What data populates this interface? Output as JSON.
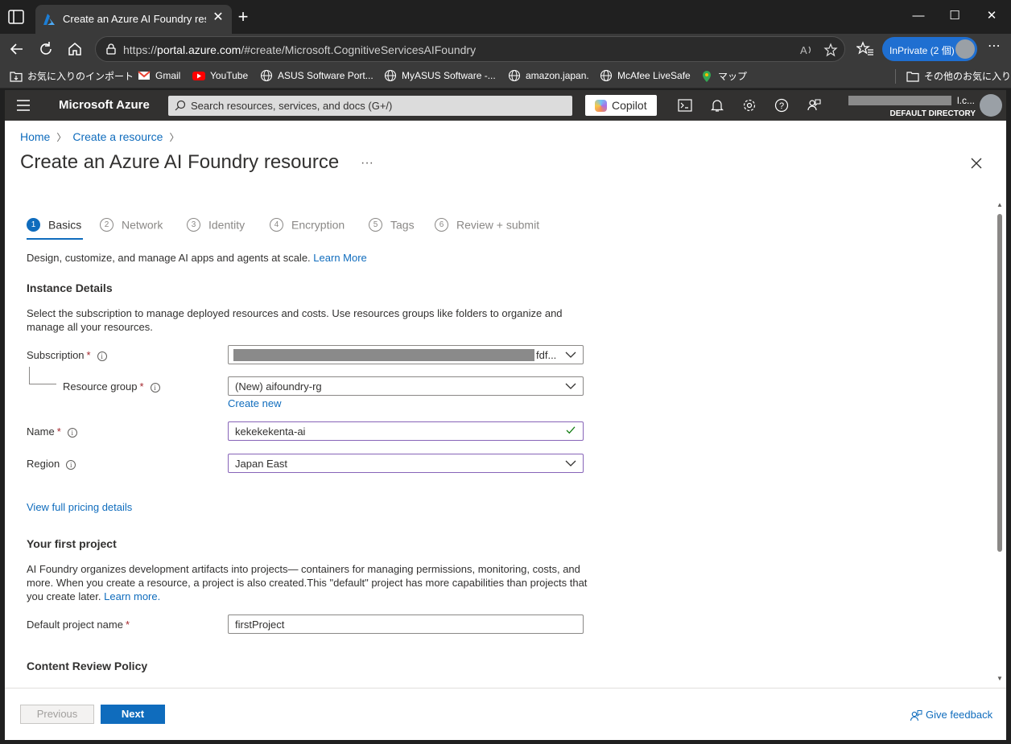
{
  "browser": {
    "tab_title": "Create an Azure AI Foundry resou",
    "url_prefix": "https://",
    "url_host": "portal.azure.com",
    "url_path": "/#create/Microsoft.CognitiveServicesAIFoundry",
    "inprivate_label": "InPrivate (2 個)"
  },
  "favorites": [
    {
      "label": "お気に入りのインポート",
      "icon": "folder-import-icon"
    },
    {
      "label": "Gmail",
      "icon": "gmail-icon"
    },
    {
      "label": "YouTube",
      "icon": "youtube-icon"
    },
    {
      "label": "ASUS Software Port...",
      "icon": "globe-icon"
    },
    {
      "label": "MyASUS Software -...",
      "icon": "globe-icon"
    },
    {
      "label": "amazon.japan.",
      "icon": "globe-icon"
    },
    {
      "label": "McAfee LiveSafe",
      "icon": "globe-icon"
    },
    {
      "label": "マップ",
      "icon": "maps-icon"
    }
  ],
  "other_favorites": "その他のお気に入り",
  "azure": {
    "brand": "Microsoft Azure",
    "search_placeholder": "Search resources, services, and docs (G+/)",
    "copilot_label": "Copilot",
    "account_suffix": "l.c...",
    "directory": "DEFAULT DIRECTORY"
  },
  "breadcrumb": [
    "Home",
    "Create a resource"
  ],
  "page_title": "Create an Azure AI Foundry resource",
  "more_label": "···",
  "steps": [
    {
      "num": "1",
      "label": "Basics",
      "active": true
    },
    {
      "num": "2",
      "label": "Network",
      "active": false
    },
    {
      "num": "3",
      "label": "Identity",
      "active": false
    },
    {
      "num": "4",
      "label": "Encryption",
      "active": false
    },
    {
      "num": "5",
      "label": "Tags",
      "active": false
    },
    {
      "num": "6",
      "label": "Review + submit",
      "active": false
    }
  ],
  "intro": {
    "text": "Design, customize, and manage AI apps and agents at scale.",
    "link": "Learn More"
  },
  "instance": {
    "heading": "Instance Details",
    "desc_line1": "Select the subscription to manage deployed resources and costs. Use resources groups like folders to organize and",
    "desc_line2": "manage all your resources."
  },
  "fields": {
    "subscription": {
      "label": "Subscription",
      "value_suffix": "fdf..."
    },
    "resource_group": {
      "label": "Resource group",
      "value": "(New) aifoundry-rg",
      "create_new": "Create new"
    },
    "name": {
      "label": "Name",
      "value": "kekekekenta-ai"
    },
    "region": {
      "label": "Region",
      "value": "Japan East"
    }
  },
  "pricing_link": "View full pricing details",
  "project": {
    "heading": "Your first project",
    "desc_line1": "AI Foundry organizes development artifacts into projects— containers for managing permissions, monitoring, costs, and",
    "desc_line2": "more. When you create a resource, a project is also created.This \"default\" project has more capabilities than projects that",
    "desc_line3": "you create later.",
    "learn_more": "Learn more.",
    "default_name_label": "Default project name",
    "default_name_value": "firstProject"
  },
  "content_review_heading": "Content Review Policy",
  "required_mark": "*",
  "footer": {
    "previous": "Previous",
    "next": "Next",
    "feedback": "Give feedback"
  },
  "colors": {
    "accent": "#0f6cbd",
    "focus_border": "#8764b8",
    "valid_check": "#107c10",
    "required": "#a4262c"
  }
}
